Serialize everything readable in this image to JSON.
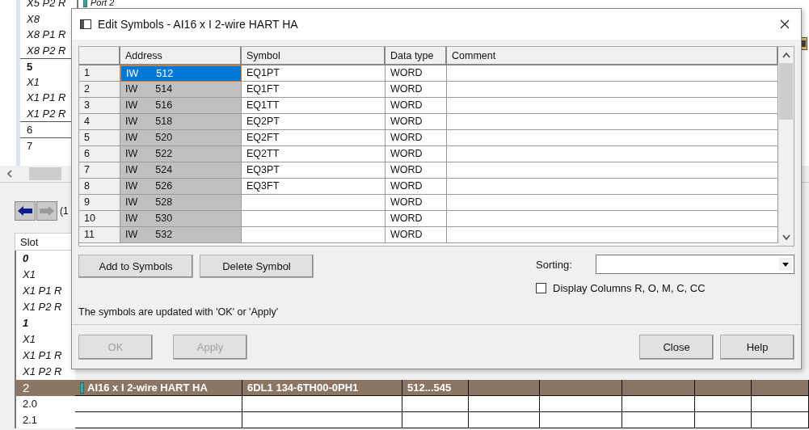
{
  "hardware_tree": {
    "top_cell": "Port 2",
    "items": [
      {
        "text": "X5 P2 R",
        "kind": "interface"
      },
      {
        "text": "X8",
        "kind": "interface"
      },
      {
        "text": "X8 P1 R",
        "kind": "interface"
      },
      {
        "text": "X8 P2 R",
        "kind": "interface"
      },
      {
        "text": "5",
        "kind": "module"
      },
      {
        "text": "X1",
        "kind": "interface"
      },
      {
        "text": "X1 P1 R",
        "kind": "interface"
      },
      {
        "text": "X1 P2 R",
        "kind": "interface"
      },
      {
        "text": "6",
        "kind": "slot"
      },
      {
        "text": "7",
        "kind": "slot"
      }
    ]
  },
  "rack_view": {
    "page_text": "(1",
    "slot_header": "Slot",
    "slots": [
      {
        "text": "0",
        "kind": "module",
        "selected": false
      },
      {
        "text": "X1",
        "kind": "interface",
        "selected": false
      },
      {
        "text": "X1 P1 R",
        "kind": "interface",
        "selected": false
      },
      {
        "text": "X1 P2 R",
        "kind": "interface",
        "selected": false
      },
      {
        "text": "1",
        "kind": "module",
        "selected": false
      },
      {
        "text": "X1",
        "kind": "interface",
        "selected": false
      },
      {
        "text": "X1 P1 R",
        "kind": "interface",
        "selected": false
      },
      {
        "text": "X1 P2 R",
        "kind": "interface",
        "selected": false
      },
      {
        "text": "2",
        "kind": "slot",
        "selected": true,
        "cells": [
          "AI16 x I 2-wire HART HA",
          "6DL1 134-6TH00-0PH1",
          "512...545"
        ]
      },
      {
        "text": "2.0",
        "kind": "slot",
        "selected": false
      },
      {
        "text": "2.1",
        "kind": "slot",
        "selected": false
      }
    ]
  },
  "dialog": {
    "title": "Edit Symbols - AI16 x I 2-wire HART HA",
    "columns": [
      "Address",
      "Symbol",
      "Data type",
      "Comment"
    ],
    "rows": [
      {
        "number": "1",
        "area": "IW",
        "address": "512",
        "symbol": "EQ1PT",
        "data_type": "WORD",
        "selected": true
      },
      {
        "number": "2",
        "area": "IW",
        "address": "514",
        "symbol": "EQ1FT",
        "data_type": "WORD",
        "selected": false
      },
      {
        "number": "3",
        "area": "IW",
        "address": "516",
        "symbol": "EQ1TT",
        "data_type": "WORD",
        "selected": false
      },
      {
        "number": "4",
        "area": "IW",
        "address": "518",
        "symbol": "EQ2PT",
        "data_type": "WORD",
        "selected": false
      },
      {
        "number": "5",
        "area": "IW",
        "address": "520",
        "symbol": "EQ2FT",
        "data_type": "WORD",
        "selected": false
      },
      {
        "number": "6",
        "area": "IW",
        "address": "522",
        "symbol": "EQ2TT",
        "data_type": "WORD",
        "selected": false
      },
      {
        "number": "7",
        "area": "IW",
        "address": "524",
        "symbol": "EQ3PT",
        "data_type": "WORD",
        "selected": false
      },
      {
        "number": "8",
        "area": "IW",
        "address": "526",
        "symbol": "EQ3FT",
        "data_type": "WORD",
        "selected": false
      },
      {
        "number": "9",
        "area": "IW",
        "address": "528",
        "symbol": "",
        "data_type": "WORD",
        "selected": false
      },
      {
        "number": "10",
        "area": "IW",
        "address": "530",
        "symbol": "",
        "data_type": "WORD",
        "selected": false
      },
      {
        "number": "11",
        "area": "IW",
        "address": "532",
        "symbol": "",
        "data_type": "WORD",
        "selected": false
      }
    ],
    "action_buttons": [
      "Add to Symbols",
      "Delete Symbol"
    ],
    "sorting": {
      "label": "Sorting:"
    },
    "display_columns": {
      "label": "Display Columns R, O, M, C, CC",
      "checked": false
    },
    "note": "The symbols are updated with 'OK' or  'Apply'",
    "footer_buttons": [
      {
        "label": "OK",
        "disabled": true
      },
      {
        "label": "Apply",
        "disabled": true
      },
      {
        "label": "Close",
        "disabled": false
      },
      {
        "label": "Help",
        "disabled": false
      }
    ]
  }
}
